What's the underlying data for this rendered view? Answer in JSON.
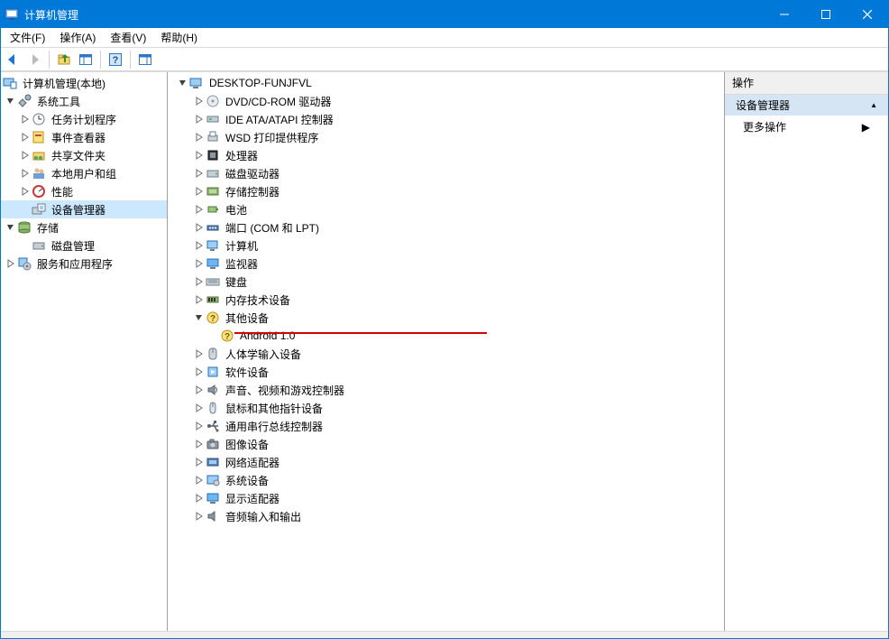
{
  "titlebar": {
    "title": "计算机管理"
  },
  "menu": {
    "file": "文件(F)",
    "action": "操作(A)",
    "view": "查看(V)",
    "help": "帮助(H)"
  },
  "left_tree": {
    "root": "计算机管理(本地)",
    "sysTools": "系统工具",
    "taskSched": "任务计划程序",
    "eventViewer": "事件查看器",
    "sharedFolders": "共享文件夹",
    "localUsers": "本地用户和组",
    "performance": "性能",
    "deviceMgr": "设备管理器",
    "storage": "存储",
    "diskMgmt": "磁盘管理",
    "services": "服务和应用程序"
  },
  "center_tree": {
    "root": "DESKTOP-FUNJFVL",
    "items": [
      "DVD/CD-ROM 驱动器",
      "IDE ATA/ATAPI 控制器",
      "WSD 打印提供程序",
      "处理器",
      "磁盘驱动器",
      "存储控制器",
      "电池",
      "端口 (COM 和 LPT)",
      "计算机",
      "监视器",
      "键盘",
      "内存技术设备",
      "其他设备",
      "人体学输入设备",
      "软件设备",
      "声音、视频和游戏控制器",
      "鼠标和其他指针设备",
      "通用串行总线控制器",
      "图像设备",
      "网络适配器",
      "系统设备",
      "显示适配器",
      "音频输入和输出"
    ],
    "otherDevChild": "Android 1.0"
  },
  "actions": {
    "title": "操作",
    "section": "设备管理器",
    "moreActions": "更多操作"
  }
}
